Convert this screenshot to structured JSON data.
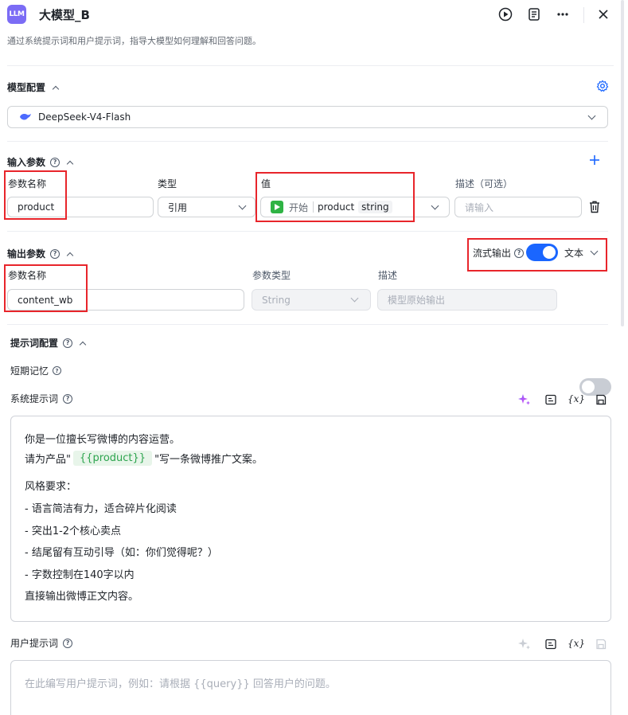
{
  "header": {
    "logo_text": "LLM",
    "title": "大模型_B",
    "description": "通过系统提示词和用户提示词，指导大模型如何理解和回答问题。"
  },
  "model_config": {
    "title": "模型配置",
    "selected_model": "DeepSeek-V4-Flash"
  },
  "input_params": {
    "title": "输入参数",
    "col_name": "参数名称",
    "col_type": "类型",
    "col_value": "值",
    "col_desc": "描述（可选）",
    "row": {
      "name": "product",
      "type": "引用",
      "value_node": "开始",
      "value_field": "product",
      "value_type": "string",
      "desc_placeholder": "请输入"
    }
  },
  "output_params": {
    "title": "输出参数",
    "stream_label": "流式输出",
    "stream_on": true,
    "format": "文本",
    "col_name": "参数名称",
    "col_type": "参数类型",
    "col_desc": "描述",
    "row": {
      "name": "content_wb",
      "type": "String",
      "desc": "模型原始输出"
    }
  },
  "prompt_config": {
    "title": "提示词配置",
    "short_memory_label": "短期记忆",
    "short_memory_on": false,
    "system_prompt_label": "系统提示词",
    "system_prompt": {
      "line1": "你是一位擅长写微博的内容运营。",
      "line2_prefix": "请为产品\"",
      "line2_var": "{{product}}",
      "line2_suffix": "\"写一条微博推广文案。",
      "line3": "风格要求：",
      "line4": "- 语言简洁有力，适合碎片化阅读",
      "line5": "- 突出1-2个核心卖点",
      "line6": "- 结尾留有互动引导（如：你们觉得呢？）",
      "line7": "- 字数控制在140字以内",
      "line8": "直接输出微博正文内容。"
    },
    "user_prompt_label": "用户提示词",
    "user_prompt_placeholder": "在此编写用户提示词，例如：请根据 {{query}} 回答用户的问题。",
    "var_tool_label": "{x}"
  },
  "colors": {
    "accent": "#1a66ff",
    "highlight_border": "#e8252b",
    "var_chip_bg": "#e8f5ea",
    "var_chip_text": "#2da44e",
    "logo_bg": "#7b6cf5"
  }
}
